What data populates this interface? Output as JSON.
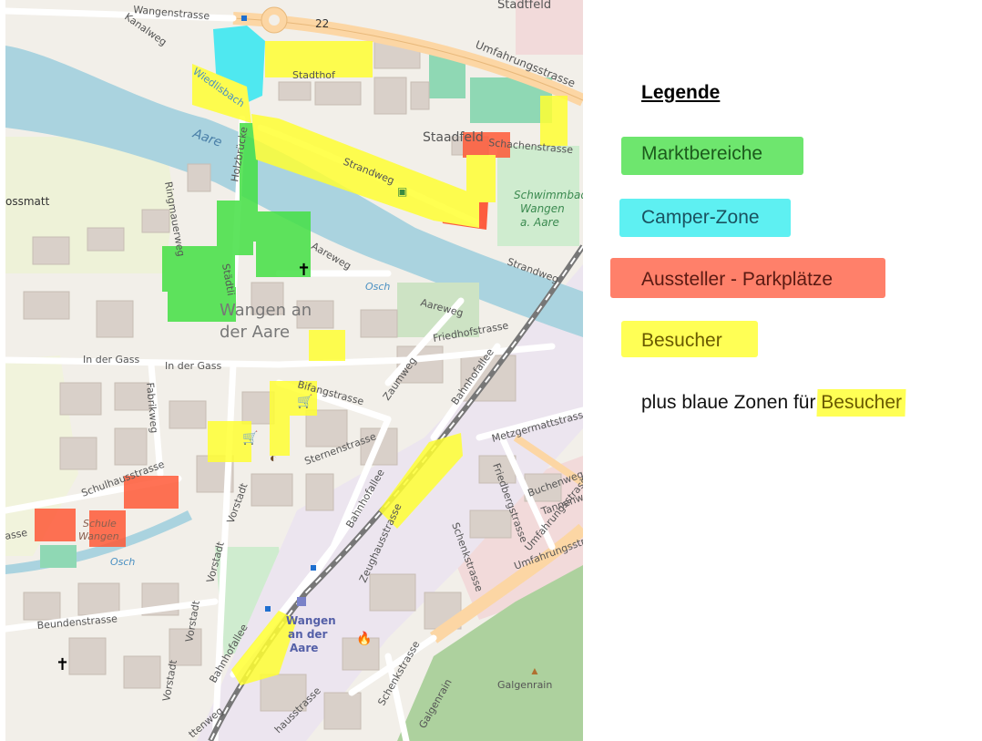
{
  "map": {
    "labels": {
      "wangenstrasse": "Wangenstrasse",
      "kanalweg": "Kanalweg",
      "road_number": "22",
      "stadtfeld": "Stadtfeld",
      "umfahrungsstrasse_top": "Umfahrungsstrasse",
      "wiedlisbach": "Wiedlisbach",
      "stadthof": "Stadthof",
      "aare": "Aare",
      "staadfeld": "Staadfeld",
      "schachenstrasse": "Schachenstrasse",
      "strandweg": "Strandweg",
      "holzbruecke": "Holzbrücke",
      "schwimmbad": "Schwimmbad",
      "schwimmbad_2": "Wangen",
      "schwimmbad_3": "a. Aare",
      "strandweg_right": "Strandweg",
      "ossmatt": "ossmatt",
      "ringmauerweg": "Ringmauerweg",
      "aareweg": "Aareweg",
      "aareweg2": "Aareweg",
      "osch": "Osch",
      "stadtli": "Städtli",
      "town1": "Wangen an",
      "town2": "der Aare",
      "friedhofstrasse": "Friedhofstrasse",
      "in_der_gass1": "In der Gass",
      "in_der_gass2": "In der Gass",
      "fabrikweg": "Fabrikweg",
      "bifangstrasse": "Bifangstrasse",
      "zaumweg": "Zaumweg",
      "bahnhofallee": "Bahnhofallee",
      "metzgermattstrasse": "Metzgermattstrasse",
      "sternenstrasse": "Sternenstrasse",
      "bahnhofallee2": "Bahnhofallee",
      "schulhausstrasse": "Schulhausstrasse",
      "schule1": "Schule",
      "schule2": "Wangen",
      "asse": "asse",
      "vorstadt": "Vorstadt",
      "friedbergstrasse": "Friedbergstrasse",
      "buchenweg": "Buchenweg",
      "tannenweg": "Tannenweg",
      "zeughausstrasse": "Zeughausstrasse",
      "schenkstrasse": "Schenkstrasse",
      "umfahrungsstrasse_right": "Umfahrungsstrasse",
      "umfahrungsstrasse_bottom": "Umfahrungsstrasse",
      "osch2": "Osch",
      "vorstadt2": "Vorstadt",
      "beundenstrasse": "Beundenstrasse",
      "vorstadt3": "Vorstadt",
      "vorstadt4": "Vorstadt",
      "bahnhofallee3": "Bahnhofallee",
      "station1": "Wangen",
      "station2": "an der",
      "station3": "Aare",
      "schenkstrasse2": "Schenkstrasse",
      "galgenrain": "Galgenrain",
      "galgenrain2": "Galgenrain",
      "hausstrasse": "hausstrasse",
      "ttenweg": "ttenweg"
    }
  },
  "legend": {
    "title": "Legende",
    "items": [
      {
        "label": "Marktbereiche",
        "color": "#44dd44"
      },
      {
        "label": "Camper-Zone",
        "color": "#33eeee"
      },
      {
        "label": "Aussteller - Parkplätze",
        "color": "#ff5533"
      },
      {
        "label": "Besucher",
        "color": "#ffff33"
      }
    ],
    "note_prefix": "plus blaue Zonen für ",
    "note_highlight": "Besucher"
  }
}
